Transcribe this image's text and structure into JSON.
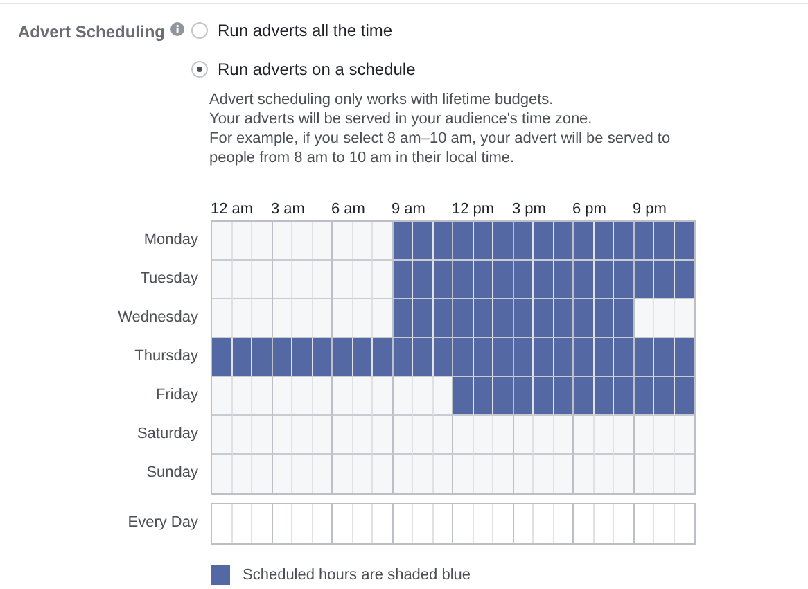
{
  "field_label": "Advert Scheduling",
  "options": [
    {
      "label": "Run adverts all the time",
      "selected": false
    },
    {
      "label": "Run adverts on a schedule",
      "selected": true
    }
  ],
  "description": [
    "Advert scheduling only works with lifetime budgets.",
    "Your adverts will be served in your audience's time zone.",
    "For example, if you select 8 am–10 am, your advert will be served to",
    "people from 8 am to 10 am in their local time."
  ],
  "time_labels": [
    "12 am",
    "3 am",
    "6 am",
    "9 am",
    "12 pm",
    "3 pm",
    "6 pm",
    "9 pm"
  ],
  "days": [
    {
      "label": "Monday",
      "hours": [
        false,
        false,
        false,
        false,
        false,
        false,
        false,
        false,
        false,
        true,
        true,
        true,
        true,
        true,
        true,
        true,
        true,
        true,
        true,
        true,
        true,
        true,
        true,
        true
      ]
    },
    {
      "label": "Tuesday",
      "hours": [
        false,
        false,
        false,
        false,
        false,
        false,
        false,
        false,
        false,
        true,
        true,
        true,
        true,
        true,
        true,
        true,
        true,
        true,
        true,
        true,
        true,
        true,
        true,
        true
      ]
    },
    {
      "label": "Wednesday",
      "hours": [
        false,
        false,
        false,
        false,
        false,
        false,
        false,
        false,
        false,
        true,
        true,
        true,
        true,
        true,
        true,
        true,
        true,
        true,
        true,
        true,
        true,
        false,
        false,
        false
      ]
    },
    {
      "label": "Thursday",
      "hours": [
        true,
        true,
        true,
        true,
        true,
        true,
        true,
        true,
        true,
        true,
        true,
        true,
        true,
        true,
        true,
        true,
        true,
        true,
        true,
        true,
        true,
        true,
        true,
        true
      ]
    },
    {
      "label": "Friday",
      "hours": [
        false,
        false,
        false,
        false,
        false,
        false,
        false,
        false,
        false,
        false,
        false,
        false,
        true,
        true,
        true,
        true,
        true,
        true,
        true,
        true,
        true,
        true,
        true,
        true
      ]
    },
    {
      "label": "Saturday",
      "hours": [
        false,
        false,
        false,
        false,
        false,
        false,
        false,
        false,
        false,
        false,
        false,
        false,
        false,
        false,
        false,
        false,
        false,
        false,
        false,
        false,
        false,
        false,
        false,
        false
      ]
    },
    {
      "label": "Sunday",
      "hours": [
        false,
        false,
        false,
        false,
        false,
        false,
        false,
        false,
        false,
        false,
        false,
        false,
        false,
        false,
        false,
        false,
        false,
        false,
        false,
        false,
        false,
        false,
        false,
        false
      ]
    }
  ],
  "every_day": {
    "label": "Every Day",
    "hours": [
      false,
      false,
      false,
      false,
      false,
      false,
      false,
      false,
      false,
      false,
      false,
      false,
      false,
      false,
      false,
      false,
      false,
      false,
      false,
      false,
      false,
      false,
      false,
      false
    ]
  },
  "legend": "Scheduled hours are shaded blue"
}
